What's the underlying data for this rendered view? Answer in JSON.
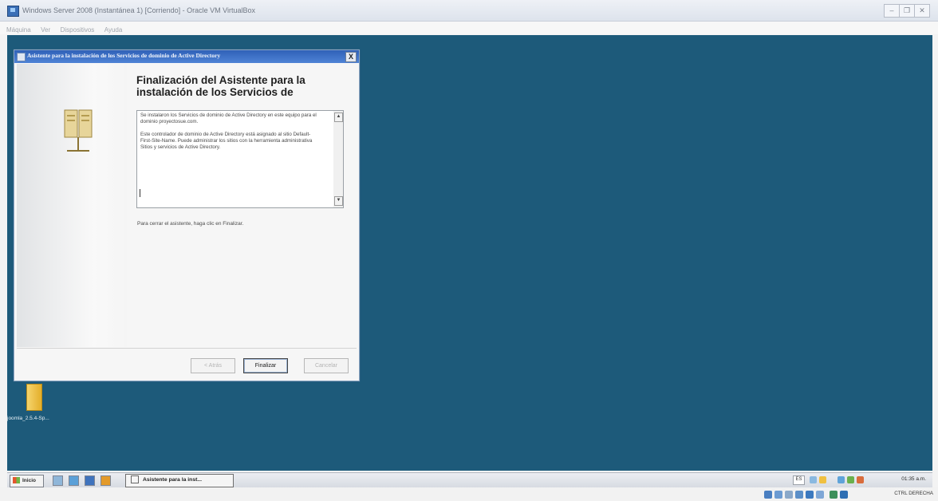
{
  "vbox": {
    "title": "Windows Server 2008 (Instantánea 1) [Corriendo] - Oracle VM VirtualBox",
    "menu": [
      "Máquina",
      "Ver",
      "Dispositivos",
      "Ayuda"
    ],
    "controls": {
      "minimize": "–",
      "restore": "❐",
      "close": "✕"
    }
  },
  "dialog": {
    "title": "Asistente para la instalación de los Servicios de dominio de Active Directory",
    "close": "X",
    "heading": "Finalización del Asistente para la instalación de los Servicios de",
    "info_p1": "Se instalaron los Servicios de dominio de Active Directory en este equipo para el dominio proyectosue.com.",
    "info_p2": "Este controlador de dominio de Active Directory está asignado al sitio Default-First-Site-Name. Puede administrar los sitios con la herramienta administrativa Sitios y servicios de Active Directory.",
    "footer_note": "Para cerrar el asistente, haga clic en Finalizar.",
    "buttons": {
      "back": "< Atrás",
      "finish": "Finalizar",
      "cancel": "Cancelar"
    }
  },
  "desktop": {
    "icon_label": "joomla_2.5.4-Sp..."
  },
  "taskbar": {
    "start": "Inicio",
    "task": "Asistente para la inst...",
    "lang": "ES",
    "clock": "01:35 a.m."
  },
  "statusbar": {
    "host_key": "CTRL DERECHA"
  },
  "colors": {
    "desktop": "#1d5a7a",
    "title_bar": "#3a6dc1",
    "taskbar": "#e2e5ea"
  }
}
